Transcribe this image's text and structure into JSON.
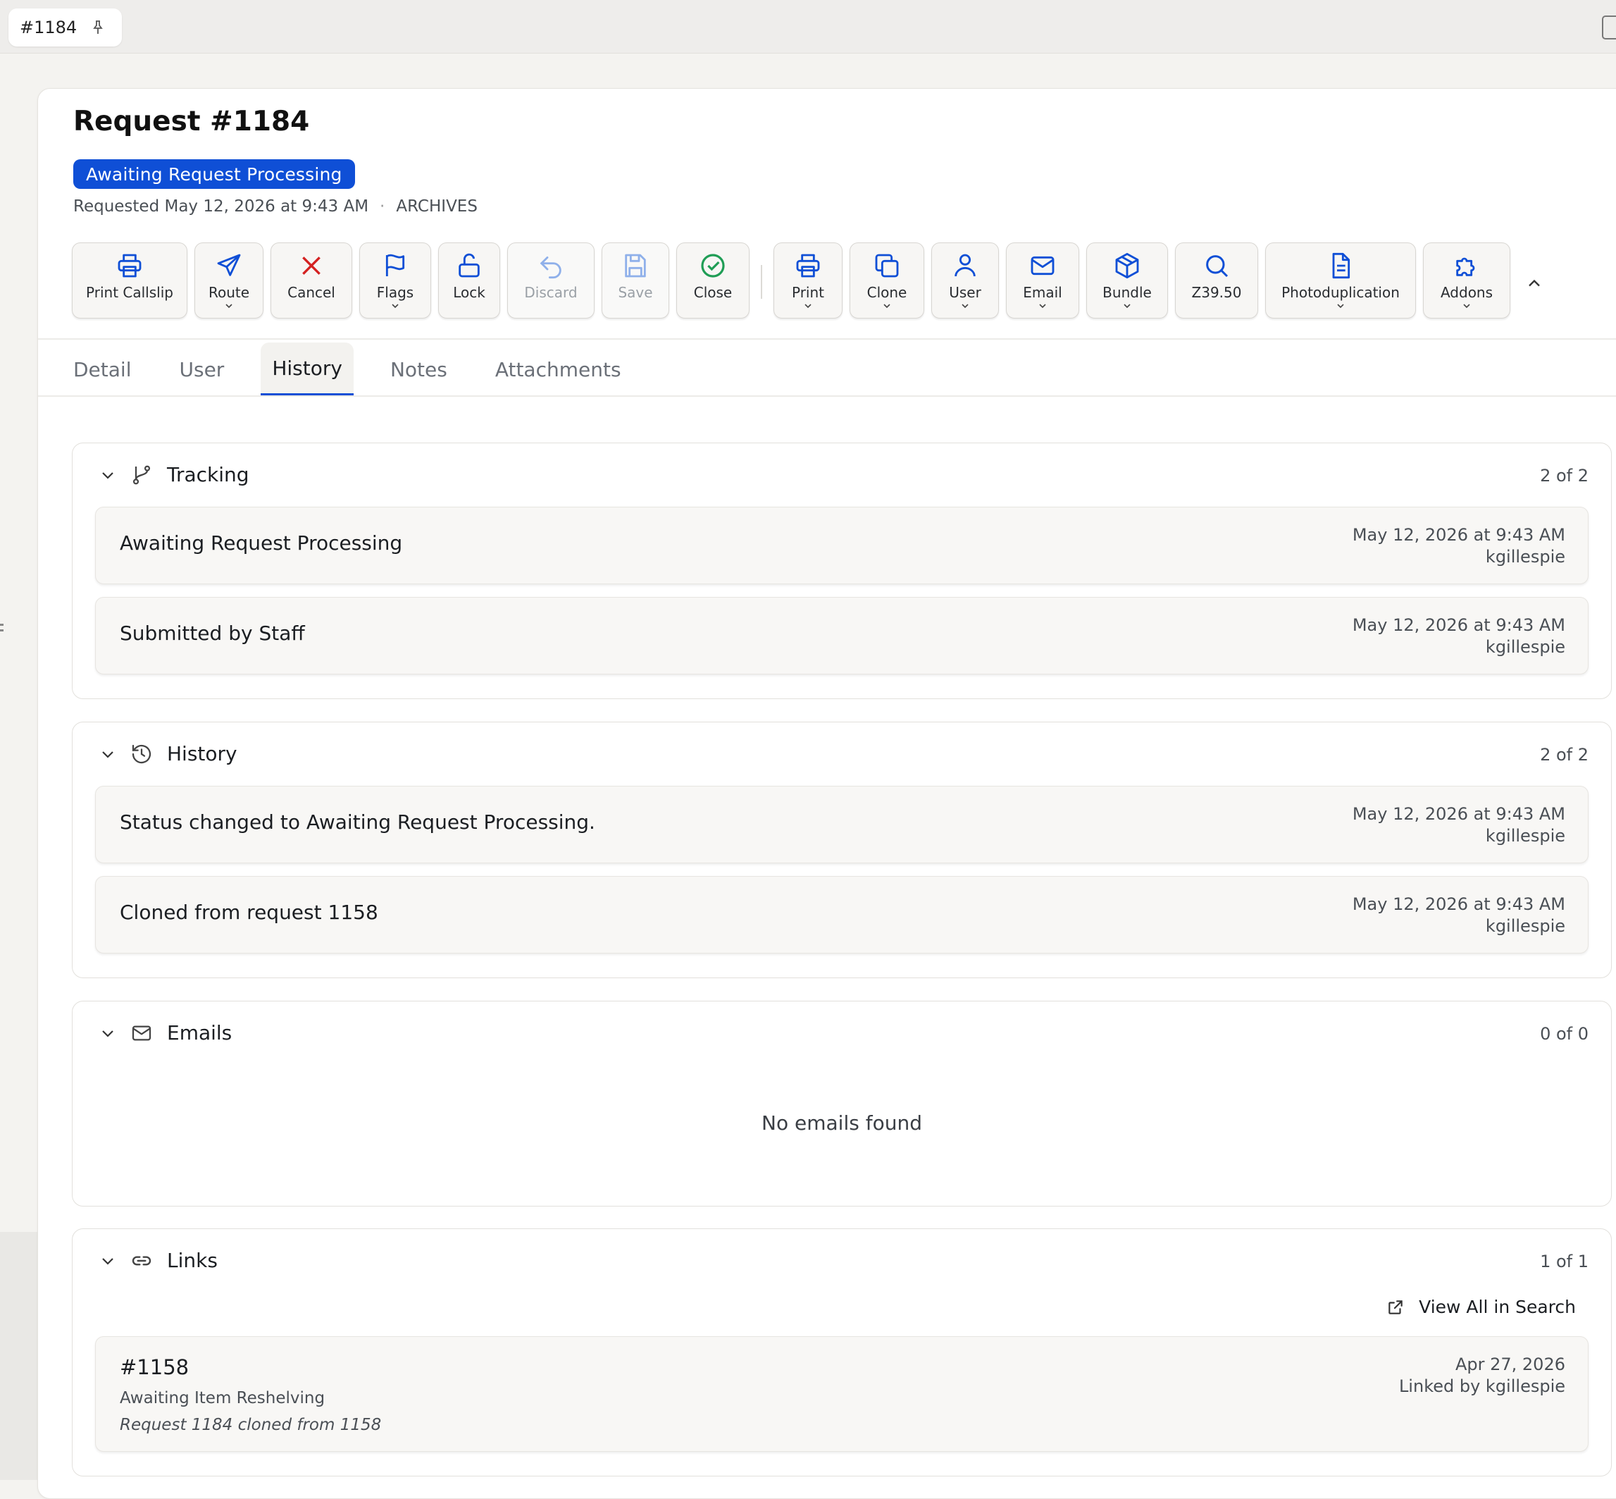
{
  "window": {
    "tab_title": "#1184"
  },
  "request": {
    "title": "Request #1184",
    "status": "Awaiting Request Processing",
    "requested": "Requested May 12, 2026 at 9:43 AM",
    "separator": "·",
    "location": "ARCHIVES"
  },
  "toolbar": {
    "print_callslip": "Print Callslip",
    "route": "Route",
    "cancel": "Cancel",
    "flags": "Flags",
    "lock": "Lock",
    "discard": "Discard",
    "save": "Save",
    "close": "Close",
    "print": "Print",
    "clone": "Clone",
    "user": "User",
    "email": "Email",
    "bundle": "Bundle",
    "z3950": "Z39.50",
    "photodup": "Photoduplication",
    "addons": "Addons"
  },
  "colors": {
    "accent": "#0f4fd6",
    "cancel": "#d42020",
    "close": "#1f9d55"
  },
  "tabs": [
    "Detail",
    "User",
    "History",
    "Notes",
    "Attachments"
  ],
  "active_tab": "History",
  "tracking": {
    "title": "Tracking",
    "count": "2 of 2",
    "entries": [
      {
        "text": "Awaiting Request Processing",
        "date": "May 12, 2026 at 9:43 AM",
        "user": "kgillespie"
      },
      {
        "text": "Submitted by Staff",
        "date": "May 12, 2026 at 9:43 AM",
        "user": "kgillespie"
      }
    ]
  },
  "history": {
    "title": "History",
    "count": "2 of 2",
    "entries": [
      {
        "text": "Status changed to Awaiting Request Processing.",
        "date": "May 12, 2026 at 9:43 AM",
        "user": "kgillespie"
      },
      {
        "text": "Cloned from request 1158",
        "date": "May 12, 2026 at 9:43 AM",
        "user": "kgillespie"
      }
    ]
  },
  "emails": {
    "title": "Emails",
    "count": "0 of 0",
    "empty": "No emails found"
  },
  "links": {
    "title": "Links",
    "count": "1 of 1",
    "view_all": "View All in Search",
    "entries": [
      {
        "id": "#1158",
        "status": "Awaiting Item Reshelving",
        "note": "Request 1184 cloned from 1158",
        "date": "Apr 27, 2026",
        "linked_by": "Linked by kgillespie"
      }
    ]
  }
}
